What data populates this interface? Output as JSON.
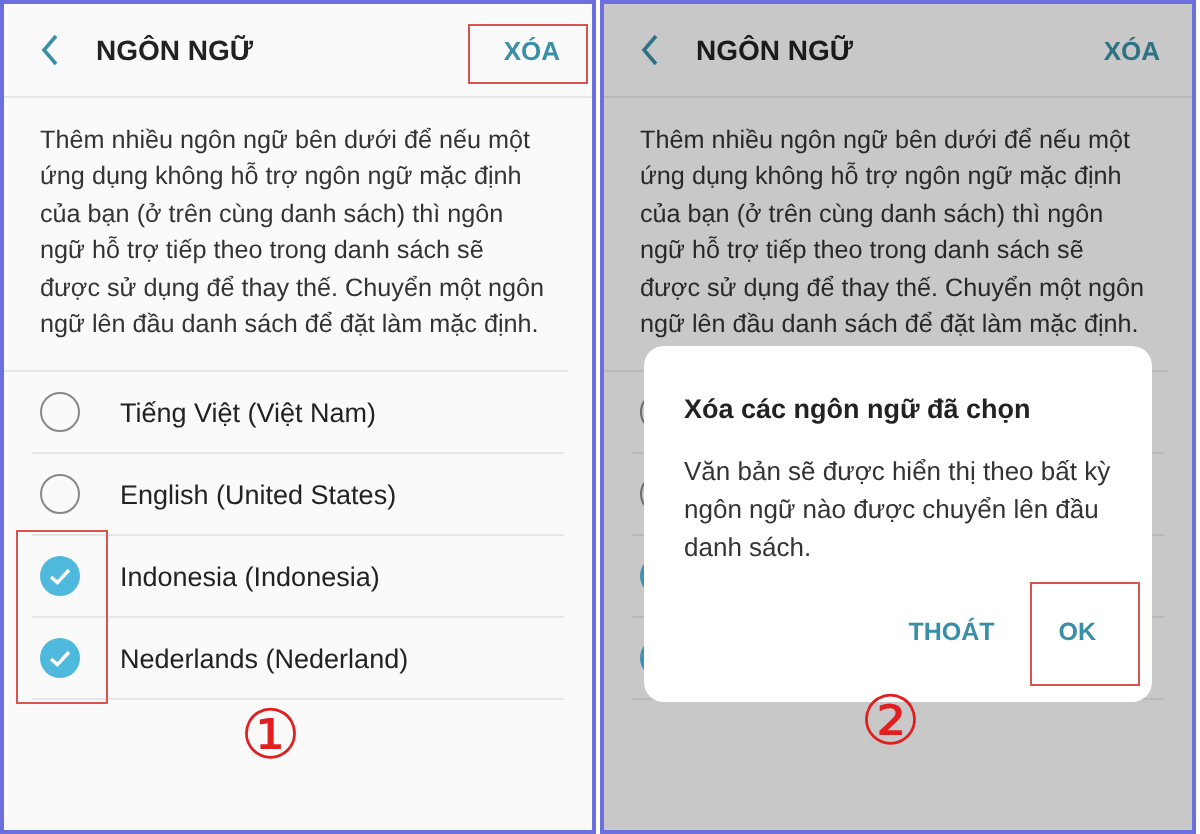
{
  "left_screen": {
    "step": "①",
    "dimmed": false,
    "header": {
      "title": "NGÔN NGỮ",
      "action": "XÓA",
      "action_highlighted": true
    },
    "description": "Thêm nhiều ngôn ngữ bên dưới để nếu một ứng dụng không hỗ trợ ngôn ngữ mặc định của bạn (ở trên cùng danh sách) thì ngôn ngữ hỗ trợ tiếp theo trong danh sách sẽ được sử dụng để thay thế. Chuyển một ngôn ngữ lên đầu danh sách để đặt làm mặc định.",
    "languages": [
      {
        "name": "Tiếng Việt (Việt Nam)",
        "checked": false,
        "highlighted": false
      },
      {
        "name": "English (United States)",
        "checked": false,
        "highlighted": false
      },
      {
        "name": "Indonesia (Indonesia)",
        "checked": true,
        "highlighted": true
      },
      {
        "name": "Nederlands (Nederland)",
        "checked": true,
        "highlighted": true
      }
    ]
  },
  "right_screen": {
    "step": "②",
    "dimmed": true,
    "header": {
      "title": "NGÔN NGỮ",
      "action": "XÓA"
    },
    "description": "Thêm nhiều ngôn ngữ bên dưới để nếu một ứng dụng không hỗ trợ ngôn ngữ mặc định của bạn (ở trên cùng danh sách) thì ngôn ngữ hỗ trợ tiếp theo trong danh sách sẽ được sử dụng để thay thế. Chuyển một ngôn ngữ lên đầu danh sách để đặt làm mặc định.",
    "languages": [
      {
        "checked": false
      },
      {
        "checked": false
      },
      {
        "checked": true
      },
      {
        "checked": true
      }
    ],
    "dialog": {
      "title": "Xóa các ngôn ngữ đã chọn",
      "message": "Văn bản sẽ được hiển thị theo bất kỳ ngôn ngữ nào được chuyển lên đầu danh sách.",
      "buttons": [
        {
          "label": "THOÁT",
          "highlighted": false
        },
        {
          "label": "OK",
          "highlighted": true
        }
      ]
    }
  }
}
